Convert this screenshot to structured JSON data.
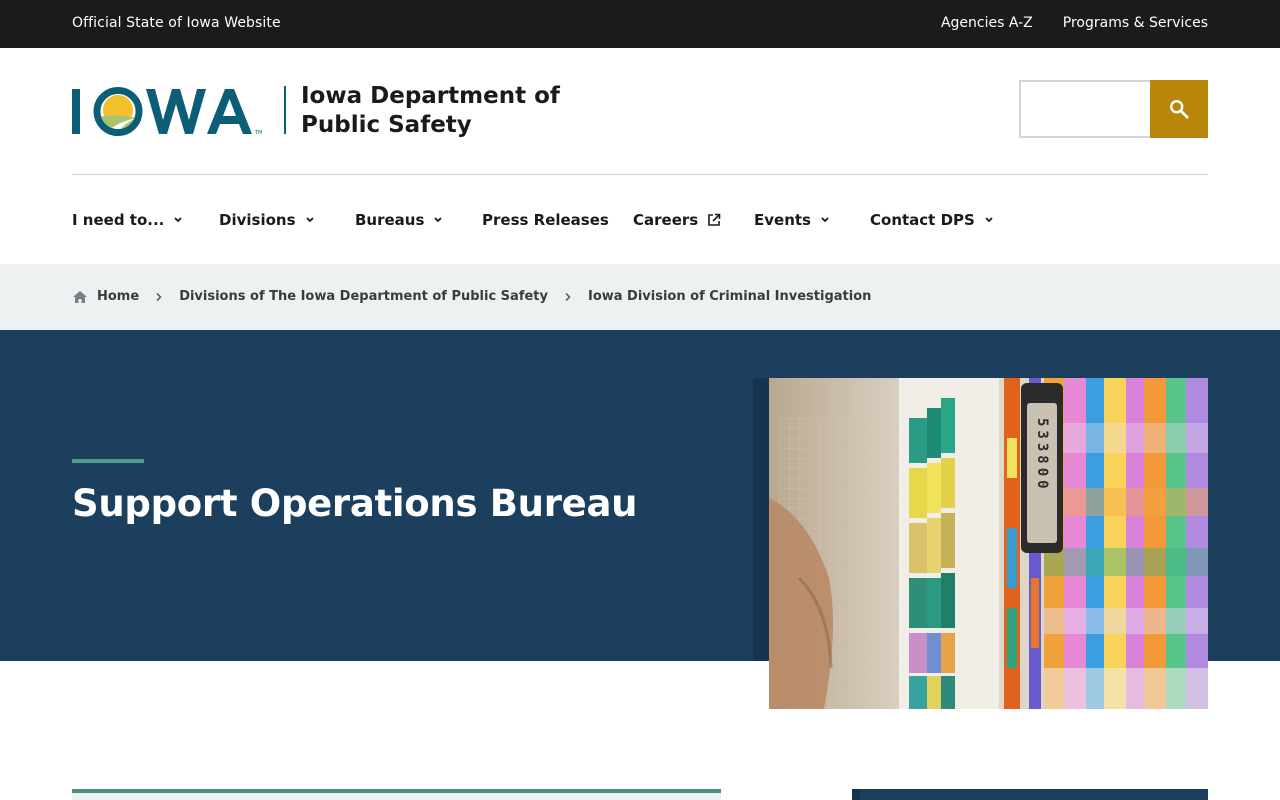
{
  "topbar": {
    "official": "Official State of Iowa Website",
    "links": [
      "Agencies A-Z",
      "Programs & Services"
    ]
  },
  "header": {
    "logo_text": "IOWA",
    "agency_name": "Iowa Department of Public Safety",
    "search_placeholder": "",
    "brand_color": "#0b5e75",
    "search_button_color": "#b7860b"
  },
  "nav": {
    "items": [
      {
        "label": "I need to...",
        "icon": "chevron-down-icon"
      },
      {
        "label": "Divisions",
        "icon": "chevron-down-icon"
      },
      {
        "label": "Bureaus",
        "icon": "chevron-down-icon"
      },
      {
        "label": "Press Releases",
        "icon": ""
      },
      {
        "label": "Careers",
        "icon": "external-link-icon"
      },
      {
        "label": "Events",
        "icon": "chevron-down-icon"
      },
      {
        "label": "Contact DPS",
        "icon": "chevron-down-icon"
      }
    ]
  },
  "breadcrumb": {
    "items": [
      "Home",
      "Divisions of The Iowa Department of Public Safety",
      "Iowa Division of Criminal Investigation"
    ]
  },
  "hero": {
    "title": "Support Operations Bureau",
    "background_color": "#1b3f5c",
    "accent_color": "#4e9c8f",
    "image_subject": "file-folders-with-colored-tabs",
    "folder_label": "533800"
  }
}
